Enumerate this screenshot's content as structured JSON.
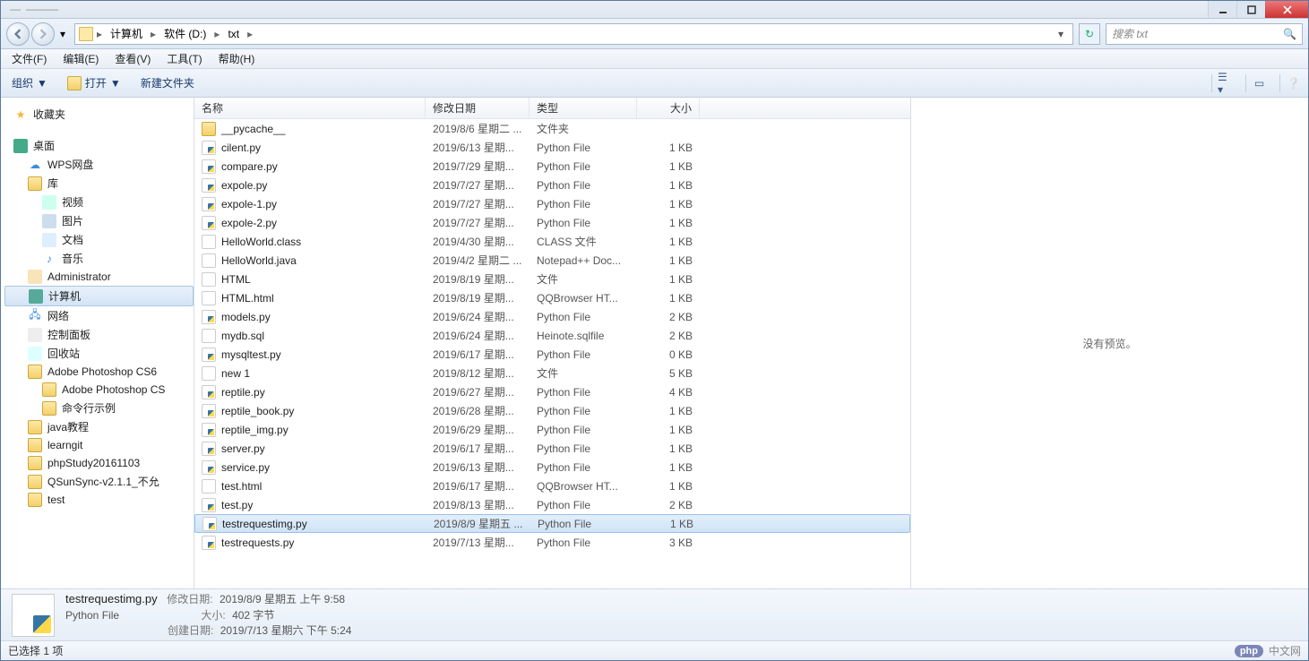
{
  "titlebar": {
    "blur1": "—",
    "blur2": "———"
  },
  "breadcrumbs": {
    "root": "计算机",
    "drive": "软件 (D:)",
    "folder": "txt"
  },
  "search": {
    "placeholder": "搜索 txt"
  },
  "menubar": {
    "file": "文件(F)",
    "edit": "编辑(E)",
    "view": "查看(V)",
    "tools": "工具(T)",
    "help": "帮助(H)"
  },
  "toolbar": {
    "organize": "组织",
    "open": "打开",
    "newfolder": "新建文件夹"
  },
  "nav": {
    "favorites": "收藏夹",
    "desktop": "桌面",
    "wps": "WPS网盘",
    "libraries": "库",
    "videos": "视频",
    "pictures": "图片",
    "documents": "文档",
    "music": "音乐",
    "user": "Administrator",
    "computer": "计算机",
    "network": "网络",
    "controlpanel": "控制面板",
    "recycle": "回收站",
    "ps": "Adobe Photoshop CS6",
    "ps2": "Adobe Photoshop CS",
    "cmd": "命令行示例",
    "java": "java教程",
    "learngit": "learngit",
    "phpstudy": "phpStudy20161103",
    "qsun": "QSunSync-v2.1.1_不允",
    "test": "test"
  },
  "columns": {
    "name": "名称",
    "date": "修改日期",
    "type": "类型",
    "size": "大小"
  },
  "files": [
    {
      "icon": "folder",
      "name": "__pycache__",
      "date": "2019/8/6 星期二 ...",
      "type": "文件夹",
      "size": ""
    },
    {
      "icon": "py",
      "name": "cilent.py",
      "date": "2019/6/13 星期...",
      "type": "Python File",
      "size": "1 KB"
    },
    {
      "icon": "py",
      "name": "compare.py",
      "date": "2019/7/29 星期...",
      "type": "Python File",
      "size": "1 KB"
    },
    {
      "icon": "py",
      "name": "expole.py",
      "date": "2019/7/27 星期...",
      "type": "Python File",
      "size": "1 KB"
    },
    {
      "icon": "py",
      "name": "expole-1.py",
      "date": "2019/7/27 星期...",
      "type": "Python File",
      "size": "1 KB"
    },
    {
      "icon": "py",
      "name": "expole-2.py",
      "date": "2019/7/27 星期...",
      "type": "Python File",
      "size": "1 KB"
    },
    {
      "icon": "file",
      "name": "HelloWorld.class",
      "date": "2019/4/30 星期...",
      "type": "CLASS 文件",
      "size": "1 KB"
    },
    {
      "icon": "file",
      "name": "HelloWorld.java",
      "date": "2019/4/2 星期二 ...",
      "type": "Notepad++ Doc...",
      "size": "1 KB"
    },
    {
      "icon": "file",
      "name": "HTML",
      "date": "2019/8/19 星期...",
      "type": "文件",
      "size": "1 KB"
    },
    {
      "icon": "html",
      "name": "HTML.html",
      "date": "2019/8/19 星期...",
      "type": "QQBrowser HT...",
      "size": "1 KB"
    },
    {
      "icon": "py",
      "name": "models.py",
      "date": "2019/6/24 星期...",
      "type": "Python File",
      "size": "2 KB"
    },
    {
      "icon": "file",
      "name": "mydb.sql",
      "date": "2019/6/24 星期...",
      "type": "Heinote.sqlfile",
      "size": "2 KB"
    },
    {
      "icon": "py",
      "name": "mysqltest.py",
      "date": "2019/6/17 星期...",
      "type": "Python File",
      "size": "0 KB"
    },
    {
      "icon": "file",
      "name": "new 1",
      "date": "2019/8/12 星期...",
      "type": "文件",
      "size": "5 KB"
    },
    {
      "icon": "py",
      "name": "reptile.py",
      "date": "2019/6/27 星期...",
      "type": "Python File",
      "size": "4 KB"
    },
    {
      "icon": "py",
      "name": "reptile_book.py",
      "date": "2019/6/28 星期...",
      "type": "Python File",
      "size": "1 KB"
    },
    {
      "icon": "py",
      "name": "reptile_img.py",
      "date": "2019/6/29 星期...",
      "type": "Python File",
      "size": "1 KB"
    },
    {
      "icon": "py",
      "name": "server.py",
      "date": "2019/6/17 星期...",
      "type": "Python File",
      "size": "1 KB"
    },
    {
      "icon": "py",
      "name": "service.py",
      "date": "2019/6/13 星期...",
      "type": "Python File",
      "size": "1 KB"
    },
    {
      "icon": "html",
      "name": "test.html",
      "date": "2019/6/17 星期...",
      "type": "QQBrowser HT...",
      "size": "1 KB"
    },
    {
      "icon": "py",
      "name": "test.py",
      "date": "2019/8/13 星期...",
      "type": "Python File",
      "size": "2 KB"
    },
    {
      "icon": "py",
      "name": "testrequestimg.py",
      "date": "2019/8/9 星期五 ...",
      "type": "Python File",
      "size": "1 KB",
      "selected": true
    },
    {
      "icon": "py",
      "name": "testrequests.py",
      "date": "2019/7/13 星期...",
      "type": "Python File",
      "size": "3 KB"
    }
  ],
  "preview": {
    "none": "没有预览。"
  },
  "details": {
    "filename": "testrequestimg.py",
    "filetype": "Python File",
    "mdate_label": "修改日期:",
    "mdate": "2019/8/9 星期五 上午 9:58",
    "size_label": "大小:",
    "size": "402 字节",
    "cdate_label": "创建日期:",
    "cdate": "2019/7/13 星期六 下午 5:24"
  },
  "status": {
    "text": "已选择 1 项",
    "brand_php": "php",
    "brand_cn": "中文网"
  }
}
